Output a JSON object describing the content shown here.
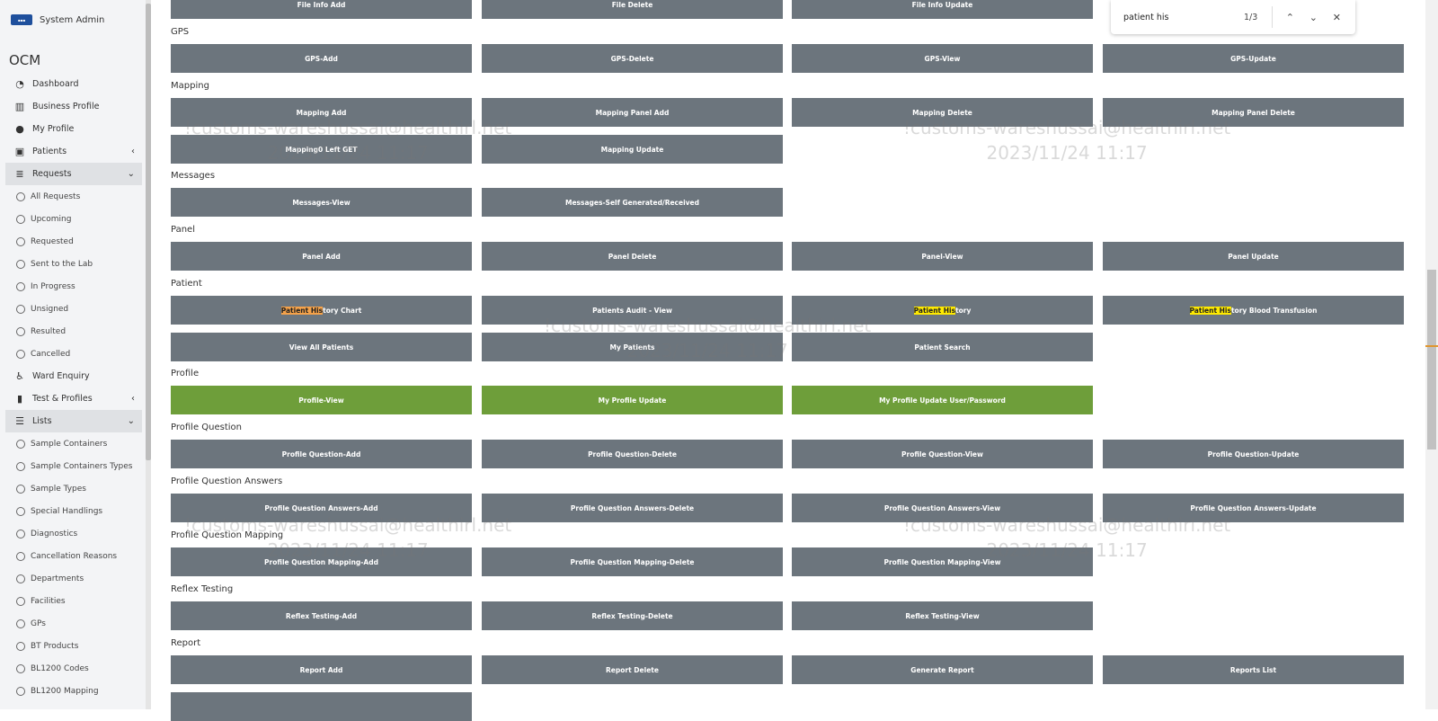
{
  "sidebar": {
    "user": "System Admin",
    "brand": "OCM",
    "items": [
      {
        "label": "Dashboard",
        "icon": "dashboard-icon",
        "glyph": "◔",
        "type": "main"
      },
      {
        "label": "Business Profile",
        "icon": "building-icon",
        "glyph": "▥",
        "type": "main"
      },
      {
        "label": "My Profile",
        "icon": "user-icon",
        "glyph": "●",
        "type": "main"
      },
      {
        "label": "Patients",
        "icon": "patient-card-icon",
        "glyph": "▣",
        "type": "main",
        "chevron": "‹"
      },
      {
        "label": "Requests",
        "icon": "database-icon",
        "glyph": "≣",
        "type": "main",
        "chevron": "⌄",
        "active": true
      },
      {
        "label": "All Requests",
        "type": "sub"
      },
      {
        "label": "Upcoming",
        "type": "sub"
      },
      {
        "label": "Requested",
        "type": "sub"
      },
      {
        "label": "Sent to the Lab",
        "type": "sub"
      },
      {
        "label": "In Progress",
        "type": "sub"
      },
      {
        "label": "Unsigned",
        "type": "sub"
      },
      {
        "label": "Resulted",
        "type": "sub"
      },
      {
        "label": "Cancelled",
        "type": "sub"
      },
      {
        "label": "Ward Enquiry",
        "icon": "wheelchair-icon",
        "glyph": "♿",
        "type": "main"
      },
      {
        "label": "Test & Profiles",
        "icon": "columns-icon",
        "glyph": "▮",
        "type": "main",
        "chevron": "‹"
      },
      {
        "label": "Lists",
        "icon": "list-icon",
        "glyph": "☰",
        "type": "main",
        "chevron": "⌄",
        "active": true
      },
      {
        "label": "Sample Containers",
        "type": "sub"
      },
      {
        "label": "Sample Containers Types",
        "type": "sub"
      },
      {
        "label": "Sample Types",
        "type": "sub"
      },
      {
        "label": "Special Handlings",
        "type": "sub"
      },
      {
        "label": "Diagnostics",
        "type": "sub"
      },
      {
        "label": "Cancellation Reasons",
        "type": "sub"
      },
      {
        "label": "Departments",
        "type": "sub"
      },
      {
        "label": "Facilities",
        "type": "sub"
      },
      {
        "label": "GPs",
        "type": "sub"
      },
      {
        "label": "BT Products",
        "type": "sub"
      },
      {
        "label": "BL1200 Codes",
        "type": "sub"
      },
      {
        "label": "BL1200 Mapping",
        "type": "sub"
      }
    ]
  },
  "find_bar": {
    "query": "patient his",
    "count": "1/3",
    "prev_glyph": "⌃",
    "next_glyph": "⌄",
    "close_glyph": "✕"
  },
  "sections": [
    {
      "title": "",
      "rows": [
        [
          "File Info Add",
          "File Delete",
          "File Info Update"
        ]
      ]
    },
    {
      "title": "GPS",
      "rows": [
        [
          "GPS-Add",
          "GPS-Delete",
          "GPS-View",
          "GPS-Update"
        ]
      ]
    },
    {
      "title": "Mapping",
      "rows": [
        [
          "Mapping Add",
          "Mapping Panel Add",
          "Mapping Delete",
          "Mapping Panel Delete"
        ],
        [
          "Mapping0 Left GET",
          "Mapping Update"
        ]
      ]
    },
    {
      "title": "Messages",
      "rows": [
        [
          "Messages-View",
          "Messages-Self Generated/Received"
        ]
      ]
    },
    {
      "title": "Panel",
      "rows": [
        [
          "Panel Add",
          "Panel Delete",
          "Panel-View",
          "Panel Update"
        ]
      ]
    },
    {
      "title": "Patient",
      "rows": [
        [
          "Patient History Chart",
          "Patients Audit - View",
          "Patient History",
          "Patient History Blood Transfusion"
        ],
        [
          "View All Patients",
          "My Patients",
          "Patient Search"
        ]
      ]
    },
    {
      "title": "Profile",
      "green": true,
      "rows": [
        [
          "Profile-View",
          "My Profile Update",
          "My Profile Update User/Password"
        ]
      ]
    },
    {
      "title": "Profile Question",
      "rows": [
        [
          "Profile Question-Add",
          "Profile Question-Delete",
          "Profile Question-View",
          "Profile Question-Update"
        ]
      ]
    },
    {
      "title": "Profile Question Answers",
      "rows": [
        [
          "Profile Question Answers-Add",
          "Profile Question Answers-Delete",
          "Profile Question Answers-View",
          "Profile Question Answers-Update"
        ]
      ]
    },
    {
      "title": "Profile Question Mapping",
      "rows": [
        [
          "Profile Question Mapping-Add",
          "Profile Question Mapping-Delete",
          "Profile Question Mapping-View"
        ]
      ]
    },
    {
      "title": "Reflex Testing",
      "rows": [
        [
          "Reflex Testing-Add",
          "Reflex Testing-Delete",
          "Reflex Testing-View"
        ]
      ]
    },
    {
      "title": "Report",
      "rows": [
        [
          "Report Add",
          "Report Delete",
          "Generate Report",
          "Reports List"
        ],
        [
          ""
        ]
      ]
    }
  ],
  "highlight": {
    "text": "Patient His",
    "current_index": 0
  },
  "watermarks": [
    {
      "line1": "!customs-wareshussai@healthirl.net",
      "line2": "2023/11/24 11:17"
    },
    {
      "line1": "!customs-wareshussai@healthirl.net",
      "line2": "2023/11/24 11:17"
    },
    {
      "line1": "!customs-wareshussai@healthirl.net",
      "line2": "2023/11/24 11:17"
    },
    {
      "line1": "!customs-wareshussai@healthirl.net",
      "line2": "2023/11/24 11:17"
    },
    {
      "line1": "!customs-wareshussai@healthirl.net",
      "line2": "2023/11/24 11:17"
    }
  ],
  "colors": {
    "button": "#6c757d",
    "button_green": "#6e9e3a",
    "highlight": "#ffea00",
    "highlight_current": "#f5a24a"
  }
}
